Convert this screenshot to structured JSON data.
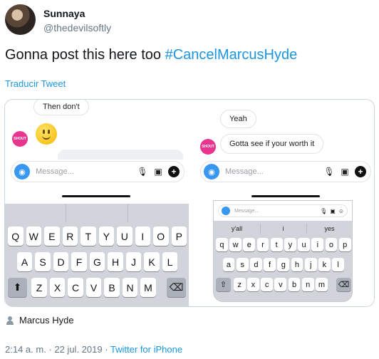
{
  "tweet": {
    "display_name": "Sunnaya",
    "handle": "@thedevilsoftly",
    "text_prefix": "Gonna post this here too ",
    "hashtag": "#CancelMarcusHyde",
    "translate_label": "Traducir Tweet",
    "tagged_user": "Marcus Hyde",
    "timestamp": "2:14 a. m. · 22 jul. 2019",
    "separator": " · ",
    "source": "Twitter for iPhone",
    "colors": {
      "accent": "#1b95e0",
      "muted": "#657786"
    }
  },
  "left_screenshot": {
    "bubble_text": "Then don't",
    "avatar_label": "SHOUT",
    "emoji": "slightly-smiling-face-emoji",
    "message_placeholder": "Message...",
    "keyboard_rows": [
      [
        "Q",
        "W",
        "E",
        "R",
        "T",
        "Y",
        "U",
        "I",
        "O",
        "P"
      ],
      [
        "A",
        "S",
        "D",
        "F",
        "G",
        "H",
        "J",
        "K",
        "L"
      ],
      [
        "⬆",
        "Z",
        "X",
        "C",
        "V",
        "B",
        "N",
        "M",
        "⌫"
      ]
    ]
  },
  "right_screenshot": {
    "bubble_1": "Yeah",
    "bubble_2": "Gotta see if your worth it",
    "avatar_label": "SHOUT",
    "message_placeholder": "Message...",
    "mini_placeholder": "Message...",
    "suggestions": [
      "y'all",
      "i",
      "yes"
    ],
    "keyboard_rows": [
      [
        "q",
        "w",
        "e",
        "r",
        "t",
        "y",
        "u",
        "i",
        "o",
        "p"
      ],
      [
        "a",
        "s",
        "d",
        "f",
        "g",
        "h",
        "j",
        "k",
        "l"
      ],
      [
        "⇧",
        "z",
        "x",
        "c",
        "v",
        "b",
        "n",
        "m",
        "⌫"
      ]
    ]
  }
}
